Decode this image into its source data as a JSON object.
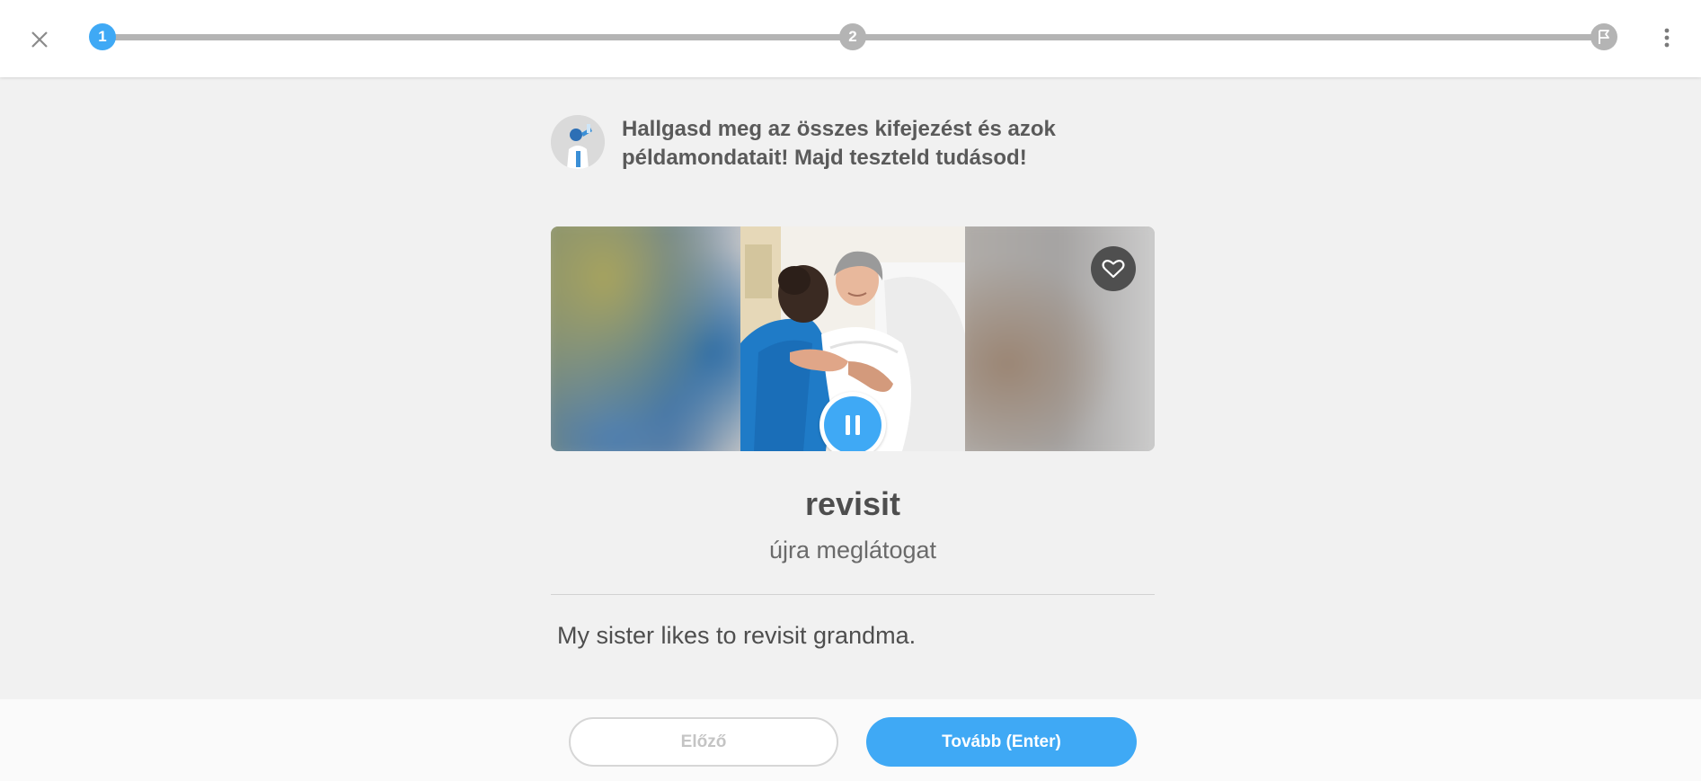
{
  "topbar": {
    "close_icon": "close-icon",
    "steps": [
      {
        "label": "1",
        "state": "active"
      },
      {
        "label": "2",
        "state": "inactive"
      }
    ],
    "finish_icon": "flag-icon",
    "more_icon": "more-vertical-icon",
    "accent_color": "#3fa9f5"
  },
  "instruction": {
    "avatar_icon": "tutor-avatar",
    "text": "Hallgasd meg az összes kifejezést és azok példamondatait! Majd teszteld tudásod!"
  },
  "card": {
    "favorite_icon": "heart-icon",
    "playback_icon": "pause-icon"
  },
  "word": {
    "term": "revisit",
    "translation": "újra meglátogat",
    "example": "My sister likes to revisit grandma."
  },
  "footer": {
    "prev_label": "Előző",
    "next_label": "Tovább (Enter)"
  }
}
